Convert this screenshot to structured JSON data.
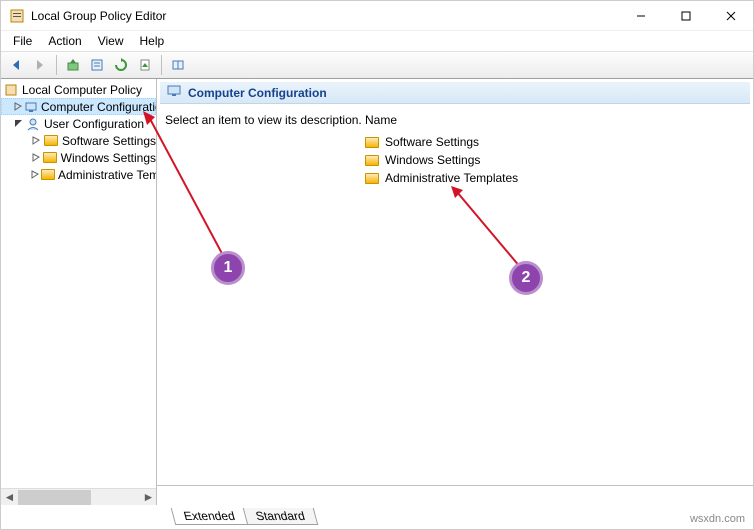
{
  "window": {
    "title": "Local Group Policy Editor"
  },
  "menu": {
    "file": "File",
    "action": "Action",
    "view": "View",
    "help": "Help"
  },
  "tree": {
    "root": "Local Computer Policy",
    "comp": "Computer Configuration",
    "user": "User Configuration",
    "sw": "Software Settings",
    "win": "Windows Settings",
    "admin": "Administrative Templates"
  },
  "content": {
    "header": "Computer Configuration",
    "desc": "Select an item to view its description.",
    "col": "Name",
    "items": [
      "Software Settings",
      "Windows Settings",
      "Administrative Templates"
    ]
  },
  "tabs": {
    "extended": "Extended",
    "standard": "Standard"
  },
  "footer": "wsxdn.com",
  "badges": {
    "one": "1",
    "two": "2"
  }
}
